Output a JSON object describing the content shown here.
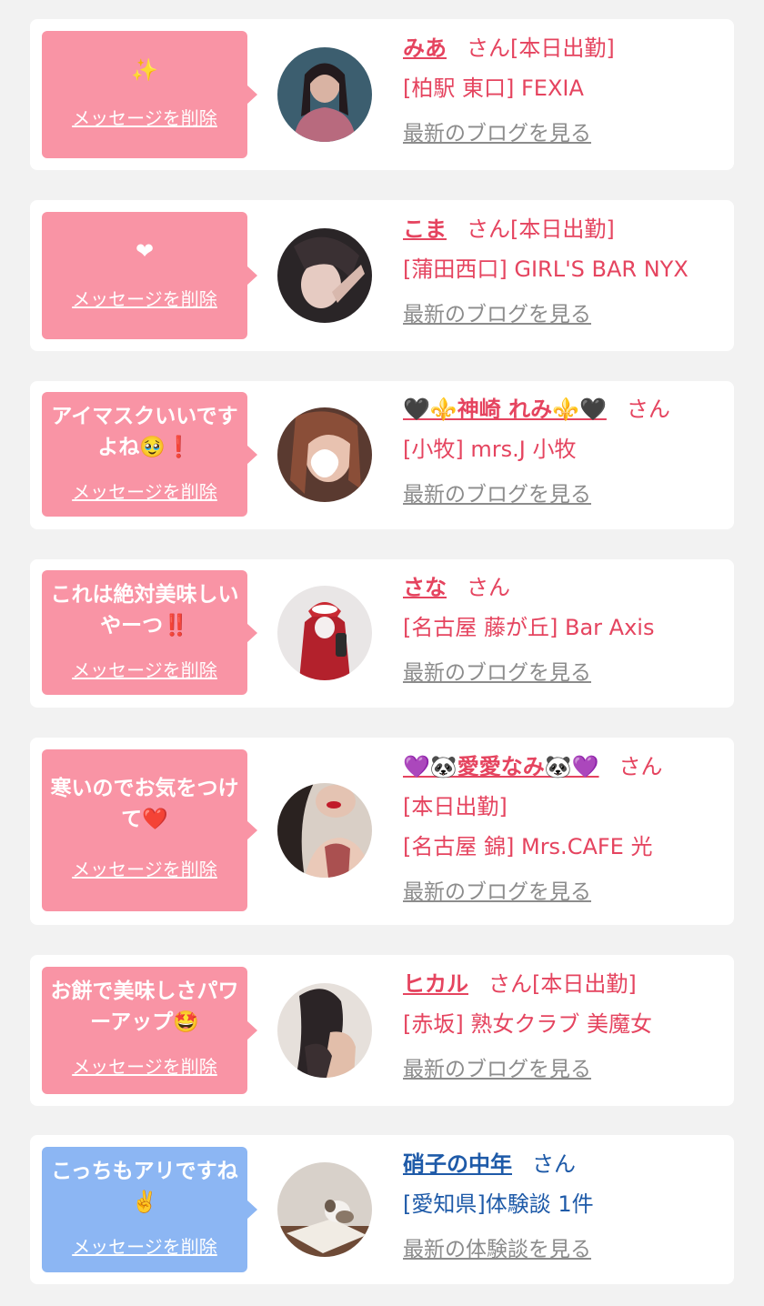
{
  "delete_label": "メッセージを削除",
  "san_label": "さん",
  "cards": [
    {
      "message": "✨",
      "name": "みあ",
      "status": "[本日出勤]",
      "shop": "[柏駅 東口] FEXIA",
      "link": "最新のブログを見る",
      "theme": "pink"
    },
    {
      "message": "❤",
      "name": "こま",
      "status": "[本日出勤]",
      "shop": "[蒲田西口] GIRL'S BAR NYX",
      "link": "最新のブログを見る",
      "theme": "pink"
    },
    {
      "message": "アイマスクいいですよね🥹❗️",
      "name": "🖤⚜️神崎 れみ⚜️🖤",
      "status": "",
      "shop": "[小牧] mrs.J 小牧",
      "link": "最新のブログを見る",
      "theme": "pink"
    },
    {
      "message": "これは絶対美味しいやーつ‼️",
      "name": "さな",
      "status": "",
      "shop": "[名古屋 藤が丘] Bar Axis",
      "link": "最新のブログを見る",
      "theme": "pink"
    },
    {
      "message": "寒いのでお気をつけて❤️",
      "name": "💜🐼愛愛なみ🐼💜",
      "status": "[本日出勤]",
      "shop": "[名古屋 錦] Mrs.CAFE 光",
      "link": "最新のブログを見る",
      "theme": "pink"
    },
    {
      "message": "お餅で美味しさパワーアップ🤩",
      "name": "ヒカル",
      "status": "[本日出勤]",
      "shop": "[赤坂] 熟女クラブ 美魔女",
      "link": "最新のブログを見る",
      "theme": "pink"
    },
    {
      "message": "こっちもアリですね✌️",
      "name": "硝子の中年",
      "status": "",
      "shop": "[愛知県]体験談 1件",
      "link": "最新の体験談を見る",
      "theme": "blue"
    }
  ],
  "colors": {
    "background": "#f2f2f2",
    "card": "#ffffff",
    "bubble_pink": "#f994a5",
    "bubble_blue": "#8cb6f3",
    "text_pink": "#e5445f",
    "text_blue": "#1e5aa8",
    "link_gray": "#8c8c8c"
  }
}
